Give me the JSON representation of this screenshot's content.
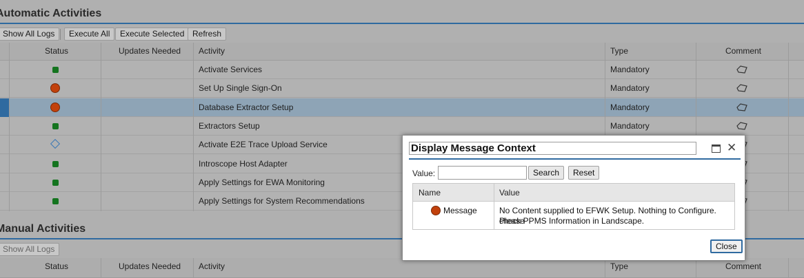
{
  "automatic": {
    "title": "Automatic Activities",
    "toolbar": {
      "show_all_logs": "Show All Logs",
      "execute_all": "Execute All",
      "execute_selected": "Execute Selected",
      "refresh": "Refresh"
    },
    "columns": {
      "status": "Status",
      "updates_needed": "Updates Needed",
      "activity": "Activity",
      "type": "Type",
      "comment": "Comment"
    },
    "rows": [
      {
        "status": "ok",
        "activity": "Activate Services",
        "type": "Mandatory"
      },
      {
        "status": "error",
        "activity": "Set Up Single Sign-On",
        "type": "Mandatory"
      },
      {
        "status": "error",
        "activity": "Database Extractor Setup",
        "type": "Mandatory",
        "selected": true
      },
      {
        "status": "ok",
        "activity": "Extractors Setup",
        "type": "Mandatory"
      },
      {
        "status": "not-started",
        "activity": "Activate E2E Trace Upload Service",
        "type": ""
      },
      {
        "status": "ok",
        "activity": "Introscope Host Adapter",
        "type": ""
      },
      {
        "status": "ok",
        "activity": "Apply Settings for EWA Monitoring",
        "type": ""
      },
      {
        "status": "ok",
        "activity": "Apply Settings for System Recommendations",
        "type": ""
      }
    ]
  },
  "manual": {
    "title": "Manual Activities",
    "toolbar": {
      "show_all_logs": "Show All Logs"
    },
    "columns": {
      "status": "Status",
      "updates_needed": "Updates Needed",
      "activity": "Activity",
      "type": "Type",
      "comment": "Comment"
    }
  },
  "dialog": {
    "title": "Display Message Context",
    "value_label": "Value:",
    "value_input": "",
    "search_label": "Search",
    "reset_label": "Reset",
    "table": {
      "col_name": "Name",
      "col_value": "Value",
      "row_name": "Message",
      "row_value_line1": "No Content supplied to EFWK Setup. Nothing to Configure. Please",
      "row_value_line2": "check PPMS Information in Landscape."
    },
    "close_label": "Close"
  },
  "colors": {
    "accent": "#2f6aa0",
    "status_ok": "#14741f",
    "status_error": "#c2410c",
    "selected_row": "#8ea4b6"
  }
}
